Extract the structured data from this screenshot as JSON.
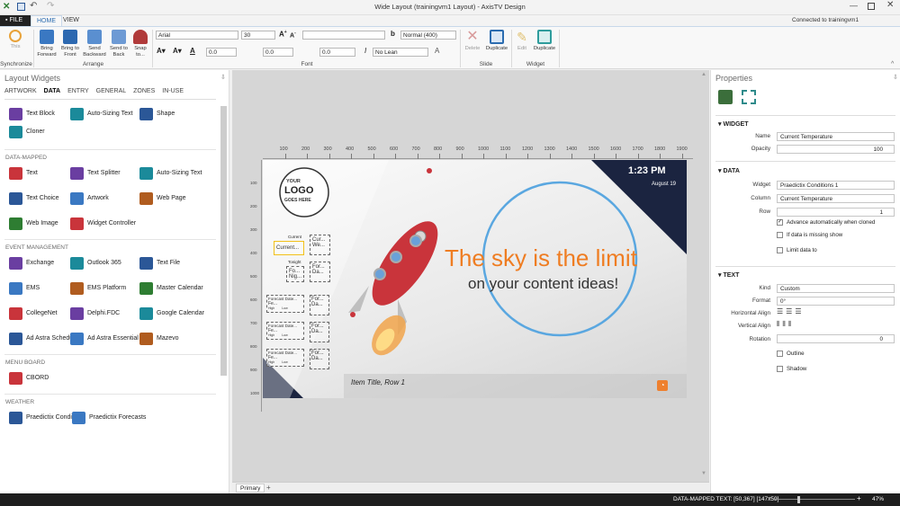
{
  "window": {
    "title": "Wide Layout (trainingvm1 Layout) - AxisTV Design"
  },
  "tabs": {
    "file": "FILE",
    "home": "HOME",
    "view": "VIEW"
  },
  "connection": "Connected to trainingvm1",
  "ribbon": {
    "sync": {
      "this": "This",
      "group": "Synchronize"
    },
    "arrange": {
      "bring_forward": "Bring Forward",
      "bring_to_front": "Bring to Front",
      "send_backward": "Send Backward",
      "send_to_back": "Send to Back",
      "snap_to": "Snap to...",
      "group": "Arrange"
    },
    "font": {
      "family": "Arial",
      "size": "30",
      "weight": "Normal (400)",
      "lean": "No Lean",
      "spacing1": "0.0",
      "spacing2": "0.0",
      "spacing3": "0.0",
      "group": "Font"
    },
    "slide": {
      "delete": "Delete",
      "duplicate": "Duplicate",
      "group": "Slide"
    },
    "widget": {
      "edit": "Edit",
      "duplicate": "Duplicate",
      "group": "Widget"
    }
  },
  "left": {
    "title": "Layout Widgets",
    "tabs": [
      "ARTWORK",
      "DATA",
      "ENTRY",
      "GENERAL",
      "ZONES",
      "IN-USE"
    ],
    "basic": [
      "Text Block",
      "Auto-Sizing Text",
      "Shape",
      "Cloner"
    ],
    "data_mapped_label": "DATA-MAPPED",
    "data_mapped": [
      "Text",
      "Text Splitter",
      "Auto-Sizing Text",
      "Text Choice",
      "Artwork",
      "Web Page",
      "Web Image",
      "Widget Controller"
    ],
    "event_label": "EVENT MANAGEMENT",
    "event": [
      "Exchange",
      "Outlook 365",
      "Text File",
      "EMS",
      "EMS Platform",
      "Master Calendar",
      "CollegeNet",
      "Delphi.FDC",
      "Google Calendar",
      "Ad Astra Schedule",
      "Ad Astra Essential",
      "Mazevo"
    ],
    "menu_label": "MENU BOARD",
    "menu": [
      "CBORD"
    ],
    "weather_label": "WEATHER",
    "weather": [
      "Praedictix Conditions",
      "Praedictix Forecasts"
    ]
  },
  "canvas": {
    "ruler": [
      "100",
      "200",
      "300",
      "400",
      "500",
      "600",
      "700",
      "800",
      "900",
      "1000",
      "1100",
      "1200",
      "1300",
      "1400",
      "1500",
      "1600",
      "1700",
      "1800",
      "1900"
    ],
    "vruler": [
      "100",
      "200",
      "300",
      "400",
      "500",
      "600",
      "700",
      "800",
      "900",
      "1000"
    ],
    "time": "1:23 PM",
    "date": "August 19",
    "logo": [
      "YOUR",
      "LOGO",
      "GOES HERE"
    ],
    "headline": "The sky is the limit",
    "subline": "on your content ideas!",
    "ticker": "Item Title, Row 1",
    "weather": {
      "current": "Current",
      "current_val": "Current...",
      "cur_we": [
        "Cur...",
        "We..."
      ],
      "tonight": "Tonight",
      "fo": [
        "Fo...",
        "Nig..."
      ],
      "for_da": [
        "For...",
        "Da..."
      ],
      "forecast": "Forecast Date...",
      "fe": "Fe...",
      "high": "High",
      "low": "Low"
    },
    "bottom_tab": "Primary",
    "add": "+"
  },
  "props": {
    "title": "Properties",
    "widget_head": "WIDGET",
    "name_label": "Name",
    "name": "Current Temperature",
    "opacity_label": "Opacity",
    "opacity": "100",
    "data_head": "DATA",
    "widget_label": "Widget",
    "widget": "Praedictix Conditions 1",
    "column_label": "Column",
    "column": "Current Temperature",
    "row_label": "Row",
    "row": "1",
    "advance": "Advance automatically when cloned",
    "missing": "If data is missing show",
    "limit": "Limit data to",
    "text_head": "TEXT",
    "kind_label": "Kind",
    "kind": "Custom",
    "format_label": "Format",
    "format": "0°",
    "halign_label": "Horizontal Align",
    "valign_label": "Vertical Align",
    "rotation_label": "Rotation",
    "rotation": "0",
    "outline": "Outline",
    "shadow": "Shadow"
  },
  "status": {
    "info": "DATA-MAPPED TEXT: [50,367] [147x59]",
    "zoom": "47%"
  },
  "colors": {
    "accent": "#2b6cb0",
    "orange": "#ef7d22",
    "navy": "#1b2440",
    "circle": "#5aa7e0"
  }
}
